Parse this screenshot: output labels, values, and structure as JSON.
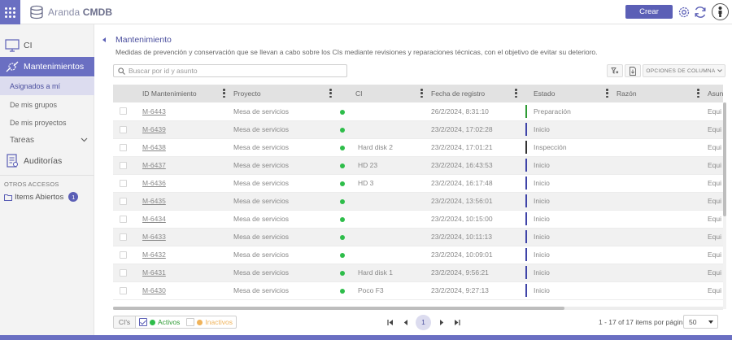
{
  "header": {
    "logo_brand": "Aranda",
    "logo_product": "CMDB",
    "create_label": "Crear",
    "icons": [
      "apps-grid-icon",
      "gear-icon",
      "refresh-icon",
      "user-avatar-icon"
    ],
    "accent": "#5b5fb6"
  },
  "sidebar": {
    "ci_label": "CI",
    "maintenance_label": "Mantenimientos",
    "sub_items": [
      "Asignados a mí",
      "De mis grupos",
      "De mis proyectos"
    ],
    "tasks_label": "Tareas",
    "audits_label": "Auditorías",
    "other_access_label": "OTROS ACCESOS",
    "open_items_label": "Items Abiertos",
    "open_items_count": "1"
  },
  "main": {
    "title": "Mantenimiento",
    "description": "Medidas de prevención y conservación que se llevan a cabo sobre los CIs mediante revisiones y reparaciones técnicas, con el objetivo de evitar su deterioro.",
    "search_placeholder": "Buscar por id y asunto",
    "columns_button": "OPCIONES DE COLUMNA"
  },
  "table": {
    "headers": [
      "ID Mantenimiento",
      "Proyecto",
      "CI",
      "Fecha de registro",
      "Estado",
      "Razón",
      "Asun"
    ],
    "rows": [
      {
        "id": "M-6443",
        "project": "Mesa de servicios",
        "ci": "",
        "date": "26/2/2024, 8:31:10",
        "status": "Preparación",
        "reason": "",
        "subject": "Equi"
      },
      {
        "id": "M-6439",
        "project": "Mesa de servicios",
        "ci": "",
        "date": "23/2/2024, 17:02:28",
        "status": "Inicio",
        "reason": "",
        "subject": "Equi"
      },
      {
        "id": "M-6438",
        "project": "Mesa de servicios",
        "ci": "Hard disk 2",
        "date": "23/2/2024, 17:01:21",
        "status": "Inspección",
        "reason": "",
        "subject": "Equi"
      },
      {
        "id": "M-6437",
        "project": "Mesa de servicios",
        "ci": "HD 23",
        "date": "23/2/2024, 16:43:53",
        "status": "Inicio",
        "reason": "",
        "subject": "Equi"
      },
      {
        "id": "M-6436",
        "project": "Mesa de servicios",
        "ci": "HD 3",
        "date": "23/2/2024, 16:17:48",
        "status": "Inicio",
        "reason": "",
        "subject": "Equi"
      },
      {
        "id": "M-6435",
        "project": "Mesa de servicios",
        "ci": "",
        "date": "23/2/2024, 13:56:01",
        "status": "Inicio",
        "reason": "",
        "subject": "Equi"
      },
      {
        "id": "M-6434",
        "project": "Mesa de servicios",
        "ci": "",
        "date": "23/2/2024, 10:15:00",
        "status": "Inicio",
        "reason": "",
        "subject": "Equi"
      },
      {
        "id": "M-6433",
        "project": "Mesa de servicios",
        "ci": "",
        "date": "23/2/2024, 10:11:13",
        "status": "Inicio",
        "reason": "",
        "subject": "Equi"
      },
      {
        "id": "M-6432",
        "project": "Mesa de servicios",
        "ci": "",
        "date": "23/2/2024, 10:09:01",
        "status": "Inicio",
        "reason": "",
        "subject": "Equi"
      },
      {
        "id": "M-6431",
        "project": "Mesa de servicios",
        "ci": "Hard disk 1",
        "date": "23/2/2024, 9:56:21",
        "status": "Inicio",
        "reason": "",
        "subject": "Equi"
      },
      {
        "id": "M-6430",
        "project": "Mesa de servicios",
        "ci": "Poco F3",
        "date": "23/2/2024, 9:27:13",
        "status": "Inicio",
        "reason": "",
        "subject": "Equi"
      }
    ],
    "status_colors": {
      "Preparación": "#2e9b34",
      "Inicio": "#3f44a8",
      "Inspección": "#333333"
    }
  },
  "footer": {
    "ci_filter": "CI's",
    "active_label": "Activos",
    "inactive_label": "Inactivos",
    "current_page": "1",
    "count_text": "1 - 17 of 17 items por página",
    "per_page": "50"
  }
}
